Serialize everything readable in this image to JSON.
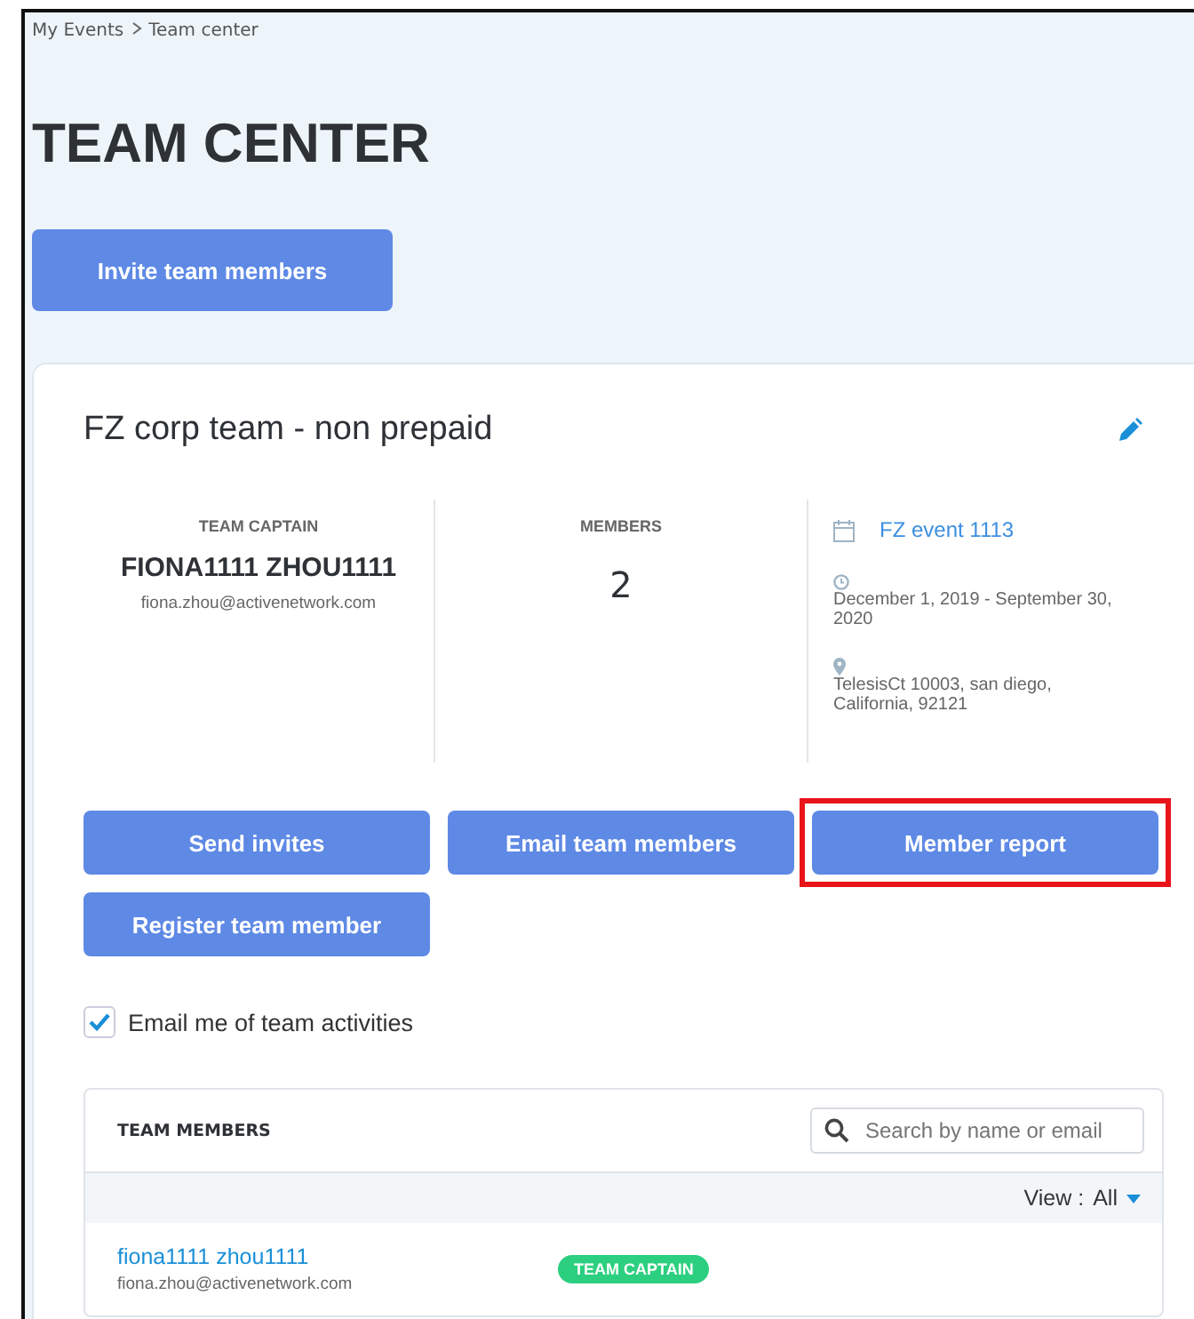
{
  "breadcrumb": [
    "My Events",
    "Team center"
  ],
  "title": "TEAM CENTER",
  "invite_button": "Invite team members",
  "team": {
    "name": "FZ corp team - non prepaid",
    "captain": {
      "label": "TEAM CAPTAIN",
      "name": "FIONA1111 ZHOU1111",
      "email": "fiona.zhou@activenetwork.com"
    },
    "members": {
      "label": "MEMBERS",
      "count": "2"
    },
    "event": {
      "name": "FZ event 1113",
      "dates": "December 1, 2019 - September 30, 2020",
      "address": "TelesisCt 10003, san diego, California, 92121"
    }
  },
  "actions": [
    {
      "label": "Send invites",
      "highlighted": false
    },
    {
      "label": "Email team members",
      "highlighted": false
    },
    {
      "label": "Member report",
      "highlighted": true
    },
    {
      "label": "Register team member",
      "highlighted": false
    }
  ],
  "email_opt": {
    "label": "Email me of team activities",
    "checked": true
  },
  "members_table": {
    "title": "TEAM MEMBERS",
    "search": {
      "placeholder": "Search by name or email"
    },
    "view_label": "View :",
    "view_value": "All",
    "rows": [
      {
        "name": "fiona1111 zhou1111",
        "email": "fiona.zhou@activenetwork.com",
        "role": "TEAM CAPTAIN"
      }
    ]
  }
}
